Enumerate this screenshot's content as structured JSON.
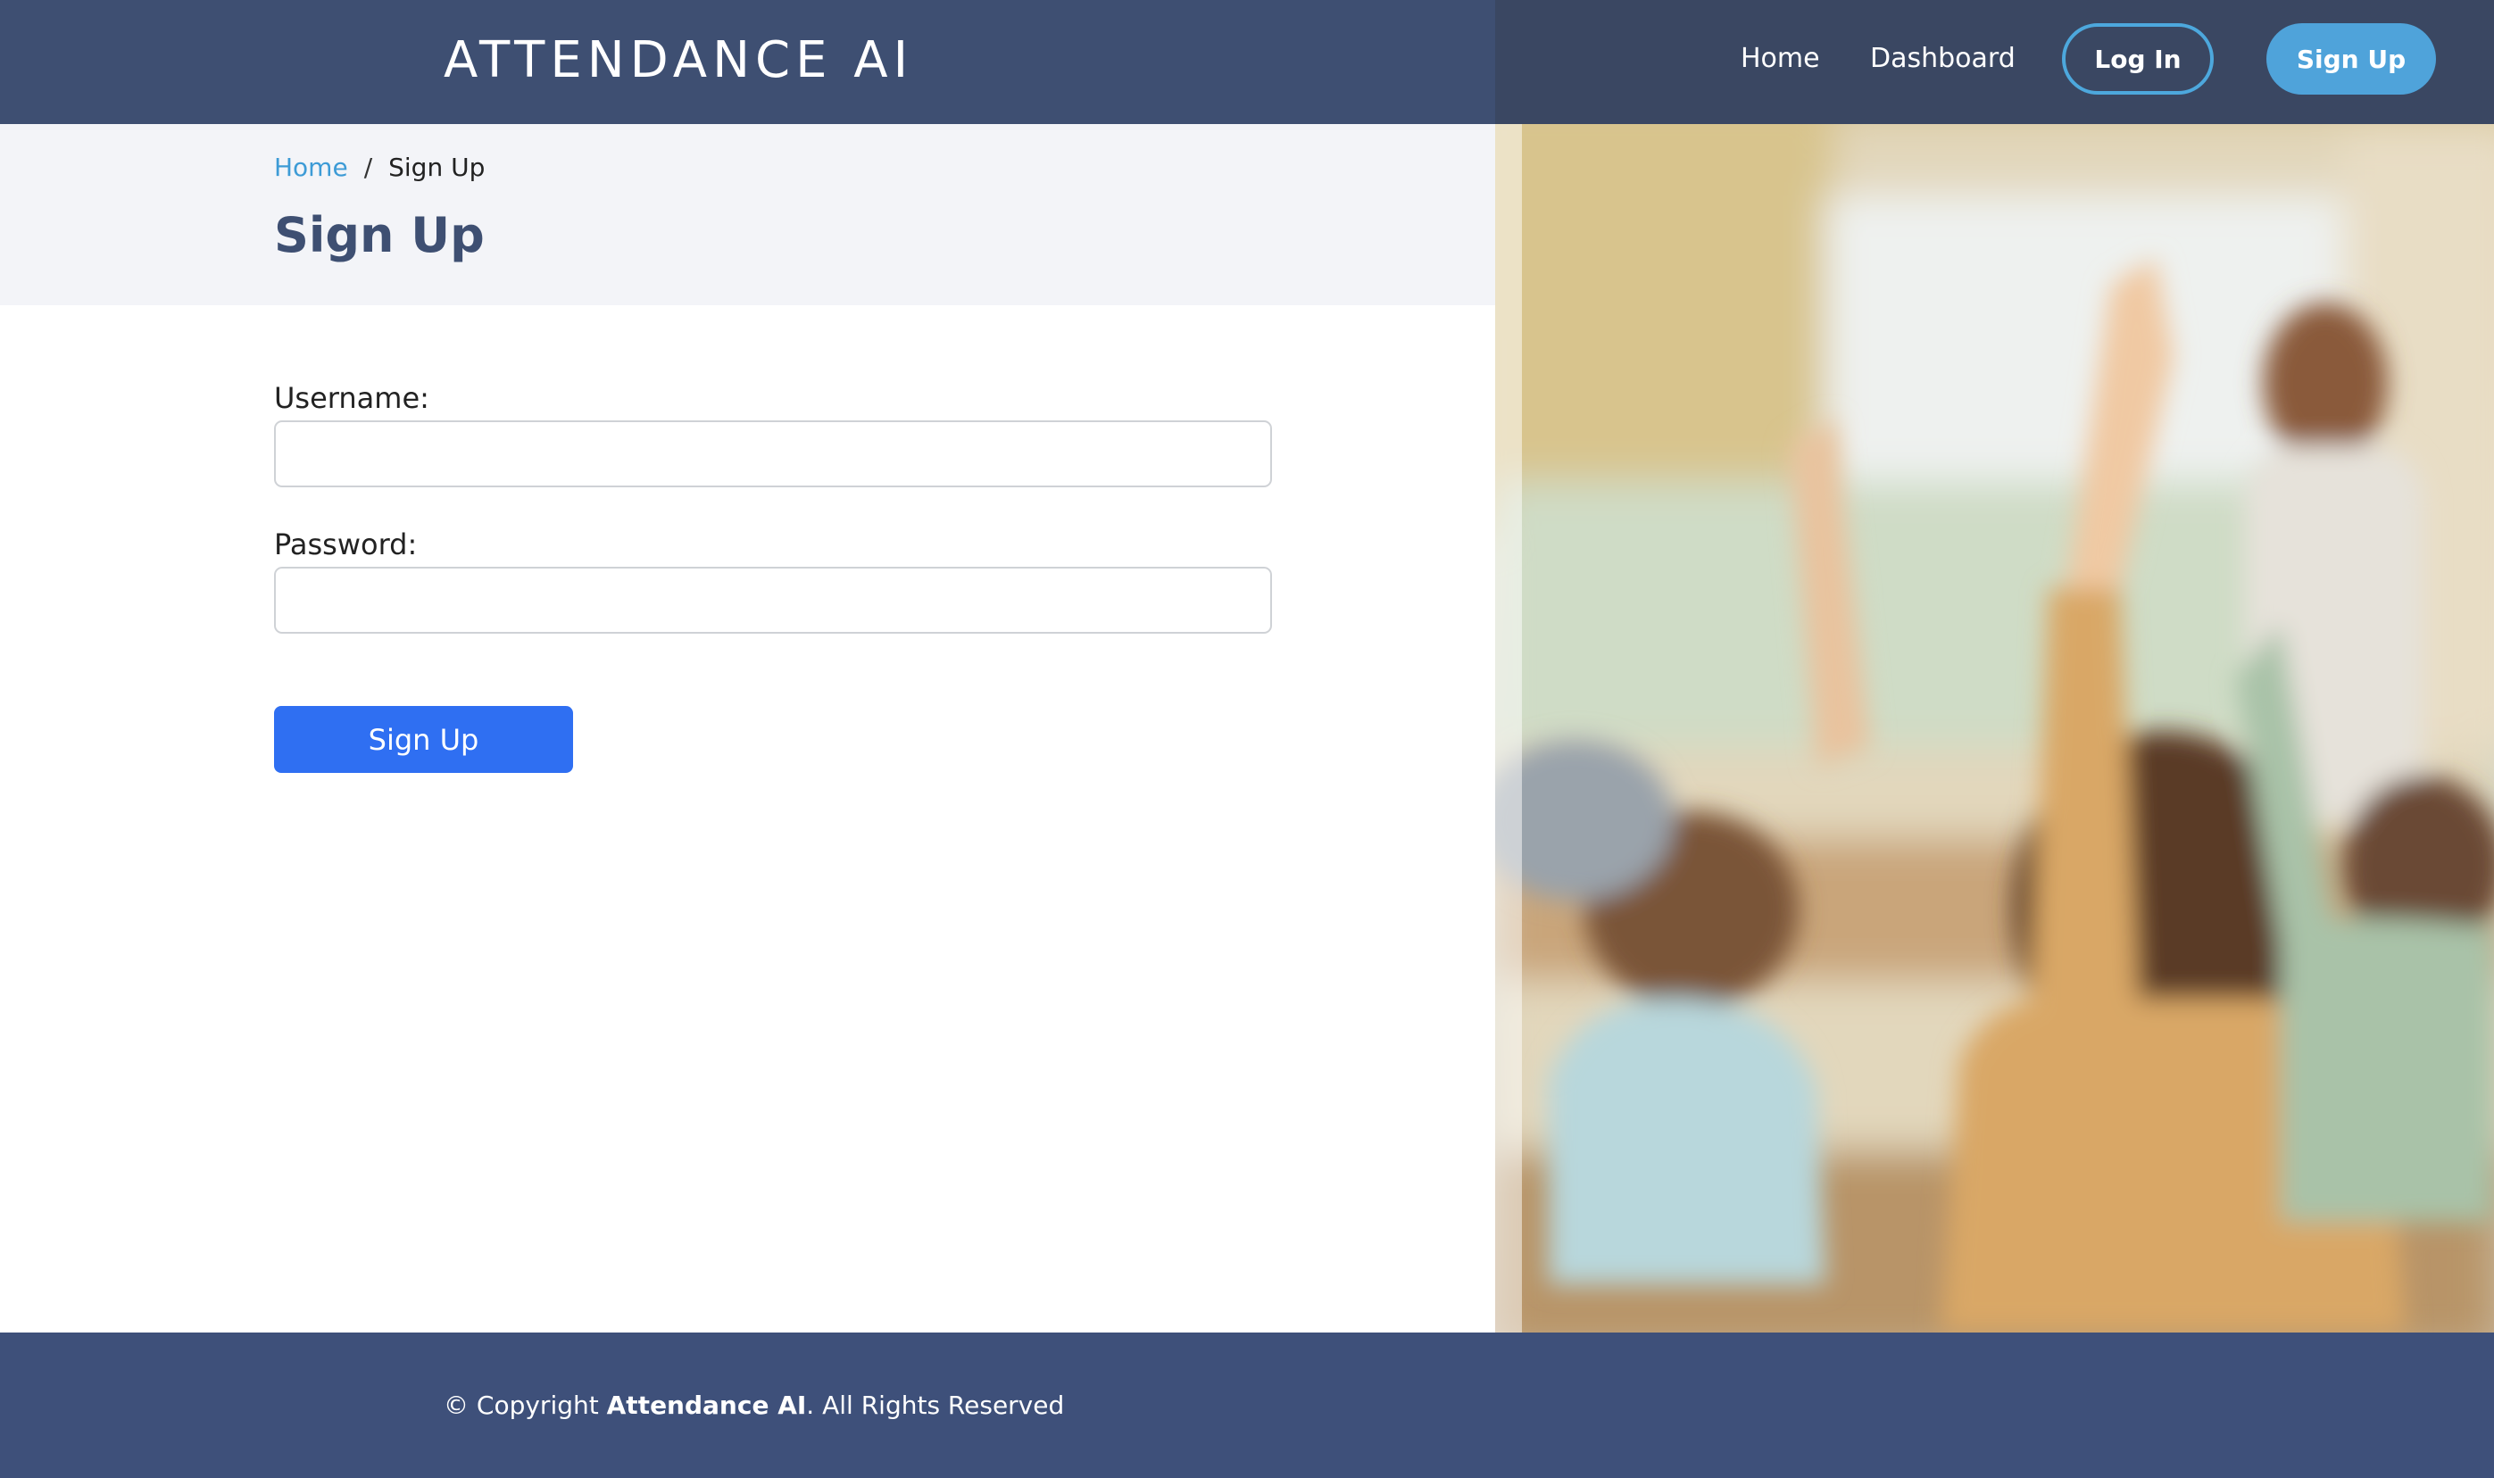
{
  "header": {
    "logo": "ATTENDANCE AI",
    "nav": {
      "home": "Home",
      "dashboard": "Dashboard",
      "login": "Log In",
      "signup": "Sign Up"
    }
  },
  "breadcrumb": {
    "home": "Home",
    "separator": "/",
    "current": "Sign Up"
  },
  "page": {
    "title": "Sign Up"
  },
  "form": {
    "username_label": "Username:",
    "username_value": "",
    "password_label": "Password:",
    "password_value": "",
    "submit_label": "Sign Up"
  },
  "footer": {
    "copyright_prefix": "© Copyright ",
    "brand": "Attendance AI",
    "copyright_suffix": ". All Rights Reserved"
  },
  "colors": {
    "header_bg": "#3e4f72",
    "footer_bg": "#3e507a",
    "accent_blue": "#4fa3da",
    "submit_blue": "#2f6ff2",
    "title_color": "#3e4f72"
  }
}
